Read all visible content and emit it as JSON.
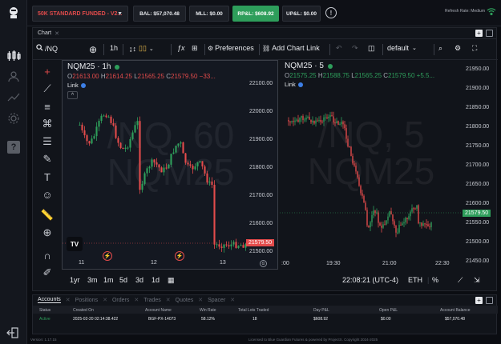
{
  "topbar": {
    "account_select": "50K STANDARD FUNDED - V2...",
    "balance": "BAL: $57,070.48",
    "mll": "MLL: $0.00",
    "rpnl": "RP&L: $608.92",
    "upnl": "UP&L: $0.00",
    "refresh": "Refresh Rate: Medium"
  },
  "panel": {
    "tab": "Chart"
  },
  "toolbar": {
    "symbol": "/NQ",
    "interval": "1h",
    "preferences": "Preferences",
    "add_chart_link": "Add Chart Link",
    "layout": "default"
  },
  "left_chart": {
    "title": "NQM25 · 1h",
    "ohlc": {
      "o": "21613.00",
      "h": "21614.25",
      "l": "21565.25",
      "c": "21579.50",
      "chg": "−33..."
    },
    "link": "Link",
    "watermark_line1": "/NQ, 60",
    "watermark_line2": "NQM25",
    "x_ticks": [
      "11",
      "12",
      "13"
    ],
    "y_ticks": [
      "22100.00",
      "22000.00",
      "21900.00",
      "21800.00",
      "21700.00",
      "21600.00",
      "21500.00"
    ],
    "last_price": "21579.50"
  },
  "right_chart": {
    "title": "NQM25 · 5",
    "ohlc": {
      "o": "21575.25",
      "h": "21588.75",
      "l": "21565.25",
      "c": "21579.50",
      "chg": "+5.5..."
    },
    "link": "Link",
    "watermark_line1": "/NQ, 5",
    "watermark_line2": "NQM25",
    "x_ticks": [
      ":00",
      "19:30",
      "21:00",
      "22:30"
    ],
    "y_ticks": [
      "21950.00",
      "21900.00",
      "21850.00",
      "21800.00",
      "21750.00",
      "21700.00",
      "21650.00",
      "21600.00",
      "21550.00",
      "21500.00",
      "21450.00"
    ],
    "last_price": "21579.50"
  },
  "bottom_nav": {
    "ranges": [
      "1yr",
      "3m",
      "1m",
      "5d",
      "3d",
      "1d"
    ],
    "clock": "22:08:21 (UTC-4)",
    "session": "ETH",
    "pct": "%"
  },
  "accounts": {
    "tabs": [
      "Accounts",
      "Positions",
      "Orders",
      "Trades",
      "Quotes",
      "Spacer"
    ],
    "headers": [
      "Status",
      "Created On",
      "Account Name",
      "Win Rate",
      "Total Lots Traded",
      "Day P&L",
      "Open P&L",
      "Account Balance"
    ],
    "row": [
      "Active",
      "2025-02-20 02:14:38.422",
      "BGF-PX-14073",
      "58.12%",
      "18",
      "$608.92",
      "$0.00",
      "$57,070.48"
    ]
  },
  "footer": {
    "version": "Version: 1.17.15",
    "license": "Licensed to Blue Guardian Futures & powered by ProjectX. Copyright 2024-2025"
  },
  "colors": {
    "up": "#2e9e5b",
    "down": "#e34b4b",
    "accent": "#3d7fe6"
  }
}
